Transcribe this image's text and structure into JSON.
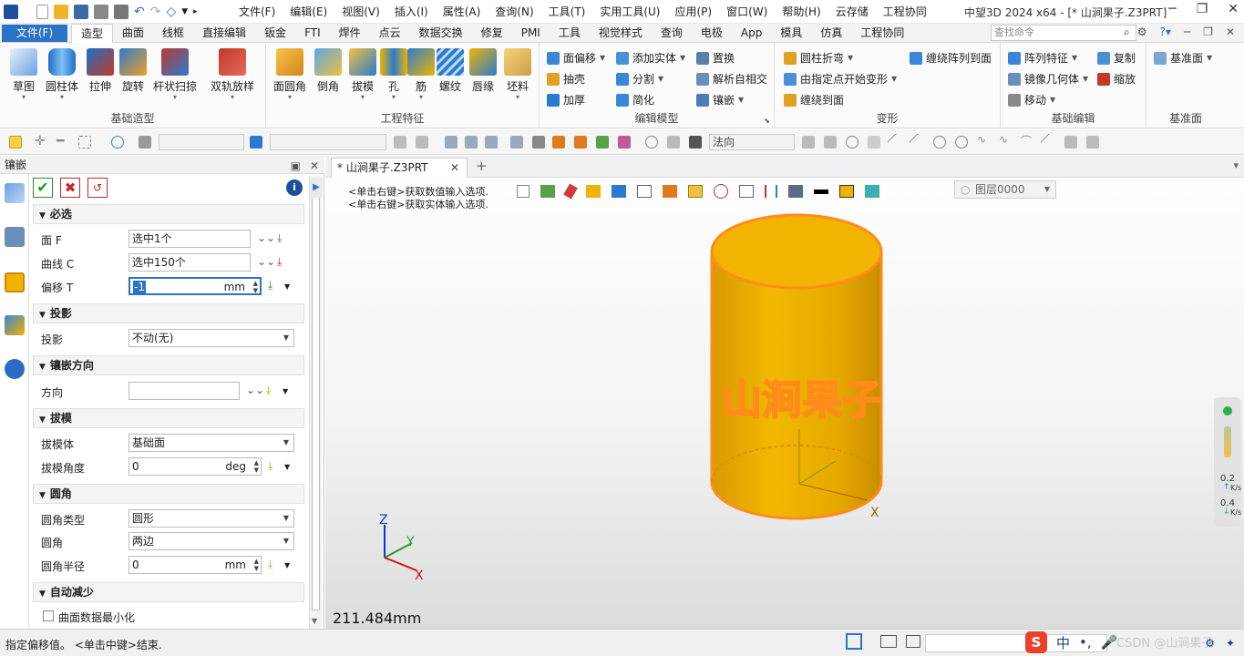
{
  "titlebar": {
    "menus": [
      "文件(F)",
      "编辑(E)",
      "视图(V)",
      "插入(I)",
      "属性(A)",
      "查询(N)",
      "工具(T)",
      "实用工具(U)",
      "应用(P)",
      "窗口(W)",
      "帮助(H)",
      "云存储",
      "工程协同"
    ],
    "window_title": "中望3D 2024 x64 - [* 山涧果子.Z3PRT]"
  },
  "ribbon_tabs": {
    "file": "文件(F)",
    "tabs": [
      "造型",
      "曲面",
      "线框",
      "直接编辑",
      "钣金",
      "FTI",
      "焊件",
      "点云",
      "数据交换",
      "修复",
      "PMI",
      "工具",
      "视觉样式",
      "查询",
      "电极",
      "App",
      "模具",
      "仿真",
      "工程协同"
    ],
    "active": "造型",
    "search_placeholder": "查找命令"
  },
  "ribbon": {
    "basic": {
      "label": "基础造型",
      "buttons": [
        "草图",
        "圆柱体",
        "拉伸",
        "旋转",
        "杆状扫掠",
        "双轨放样"
      ]
    },
    "feature": {
      "label": "工程特征",
      "buttons": [
        "面圆角",
        "倒角",
        "拔模",
        "孔",
        "筋",
        "螺纹",
        "唇缘",
        "坯料"
      ]
    },
    "edit_model": {
      "label": "编辑模型",
      "items": [
        "面偏移",
        "添加实体",
        "置换",
        "抽壳",
        "分割",
        "解析自相交",
        "加厚",
        "简化",
        "镶嵌"
      ]
    },
    "deform": {
      "label": "变形",
      "items": [
        "圆柱折弯",
        "缠绕阵列到面",
        "由指定点开始变形",
        "缠绕到面"
      ]
    },
    "basic_edit": {
      "label": "基础编辑",
      "items": [
        "阵列特征",
        "复制",
        "镜像几何体",
        "缩放",
        "移动"
      ]
    },
    "datum": {
      "label": "基准面",
      "items": [
        "基准面"
      ]
    }
  },
  "toolbar2": {
    "normal_combo": "法向"
  },
  "panel": {
    "title": "镶嵌",
    "sections": {
      "required": "必选",
      "projection": "投影",
      "direction": "镶嵌方向",
      "draft": "拔模",
      "fillet": "圆角",
      "auto": "自动减少"
    },
    "fields": {
      "face_label": "面 F",
      "face_value": "选中1个",
      "curve_label": "曲线 C",
      "curve_value": "选中150个",
      "offset_label": "偏移 T",
      "offset_value": "-1",
      "offset_unit": "mm",
      "proj_label": "投影",
      "proj_value": "不动(无)",
      "dir_label": "方向",
      "dir_value": "",
      "draft_body_label": "拔模体",
      "draft_body_value": "基础面",
      "draft_angle_label": "拔模角度",
      "draft_angle_value": "0",
      "draft_angle_unit": "deg",
      "fillet_type_label": "圆角类型",
      "fillet_type_value": "圆形",
      "fillet_label": "圆角",
      "fillet_value": "两边",
      "fillet_radius_label": "圆角半径",
      "fillet_radius_value": "0",
      "fillet_radius_unit": "mm",
      "minimize_label": "曲面数据最小化"
    }
  },
  "viewport": {
    "doc_tab": "* 山涧果子.Z3PRT",
    "prompt1": "<单击右键>获取数值输入选项.",
    "prompt2": "<单击右键>获取实体输入选项.",
    "layer": "图层0000",
    "measure": "211.484mm",
    "embossed_text": "山涧果子",
    "axis_x": "X",
    "axis_y": "Y",
    "axis_z": "Z",
    "net_up": "0.2",
    "net_down": "0.4",
    "net_unit": "K/s"
  },
  "statusbar": {
    "text": "指定偏移值。 <单击中键>结束.",
    "ime": "中",
    "watermark": "CSDN @山涧果子"
  },
  "colors": {
    "accent": "#2b73c6",
    "part": "#f0b400",
    "edge": "#ff8c1a"
  }
}
